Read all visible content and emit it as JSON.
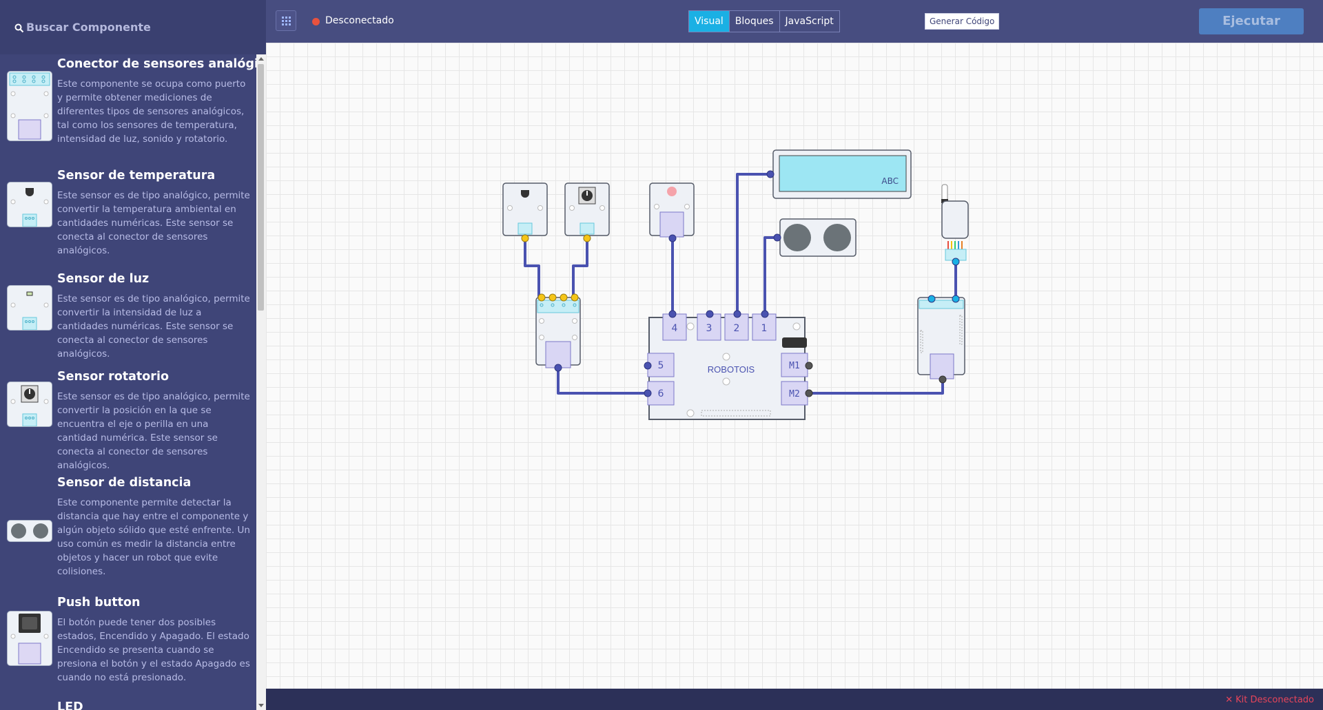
{
  "sidebar": {
    "search_label": "Buscar Componente",
    "components": [
      {
        "name": "Conector de sensores analógicos",
        "description": "Este componente se ocupa como puerto y permite obtener mediciones de diferentes tipos de sensores analógicos, tal como los sensores de temperatura, intensidad de luz, sonido y rotatorio."
      },
      {
        "name": "Sensor de temperatura",
        "description": "Este sensor es de tipo analógico, permite convertir la temperatura ambiental en cantidades numéricas. Este sensor se conecta al conector de sensores analógicos."
      },
      {
        "name": "Sensor de luz",
        "description": "Este sensor es de tipo analógico, permite convertir la intensidad de luz a cantidades numéricas. Este sensor se conecta al conector de sensores analógicos."
      },
      {
        "name": "Sensor rotatorio",
        "description": "Este sensor es de tipo analógico, permite convertir la posición en la que se encuentra el eje o perilla en una cantidad numérica. Este sensor se conecta al conector de sensores analógicos."
      },
      {
        "name": "Sensor de distancia",
        "description": "Este componente permite detectar la distancia que hay entre el componente y algún objeto sólido que esté enfrente. Un uso común es medir la distancia entre objetos y hacer un robot que evite colisiones."
      },
      {
        "name": "Push button",
        "description": "El botón puede tener dos posibles estados, Encendido y Apagado. El estado Encendido se presenta cuando se presiona el botón y el estado Apagado es cuando no está presionado."
      },
      {
        "name": "LED",
        "description": ""
      }
    ]
  },
  "topbar": {
    "status": "Desconectado",
    "status_color": "#e9523e",
    "tabs": [
      {
        "label": "Visual",
        "active": true
      },
      {
        "label": "Bloques",
        "active": false
      },
      {
        "label": "JavaScript",
        "active": false
      }
    ],
    "generate_code_label": "Generar Código",
    "run_label": "Ejecutar"
  },
  "canvas": {
    "board_label": "ROBOTOIS",
    "board_ports": [
      "4",
      "3",
      "2",
      "1",
      "5",
      "6",
      "M1",
      "M2"
    ],
    "lcd_text": "ABC",
    "wire_color": "#4a52b0",
    "pin_yellow": "#f5c518"
  },
  "footer": {
    "kit_status": "Kit Desconectado"
  }
}
